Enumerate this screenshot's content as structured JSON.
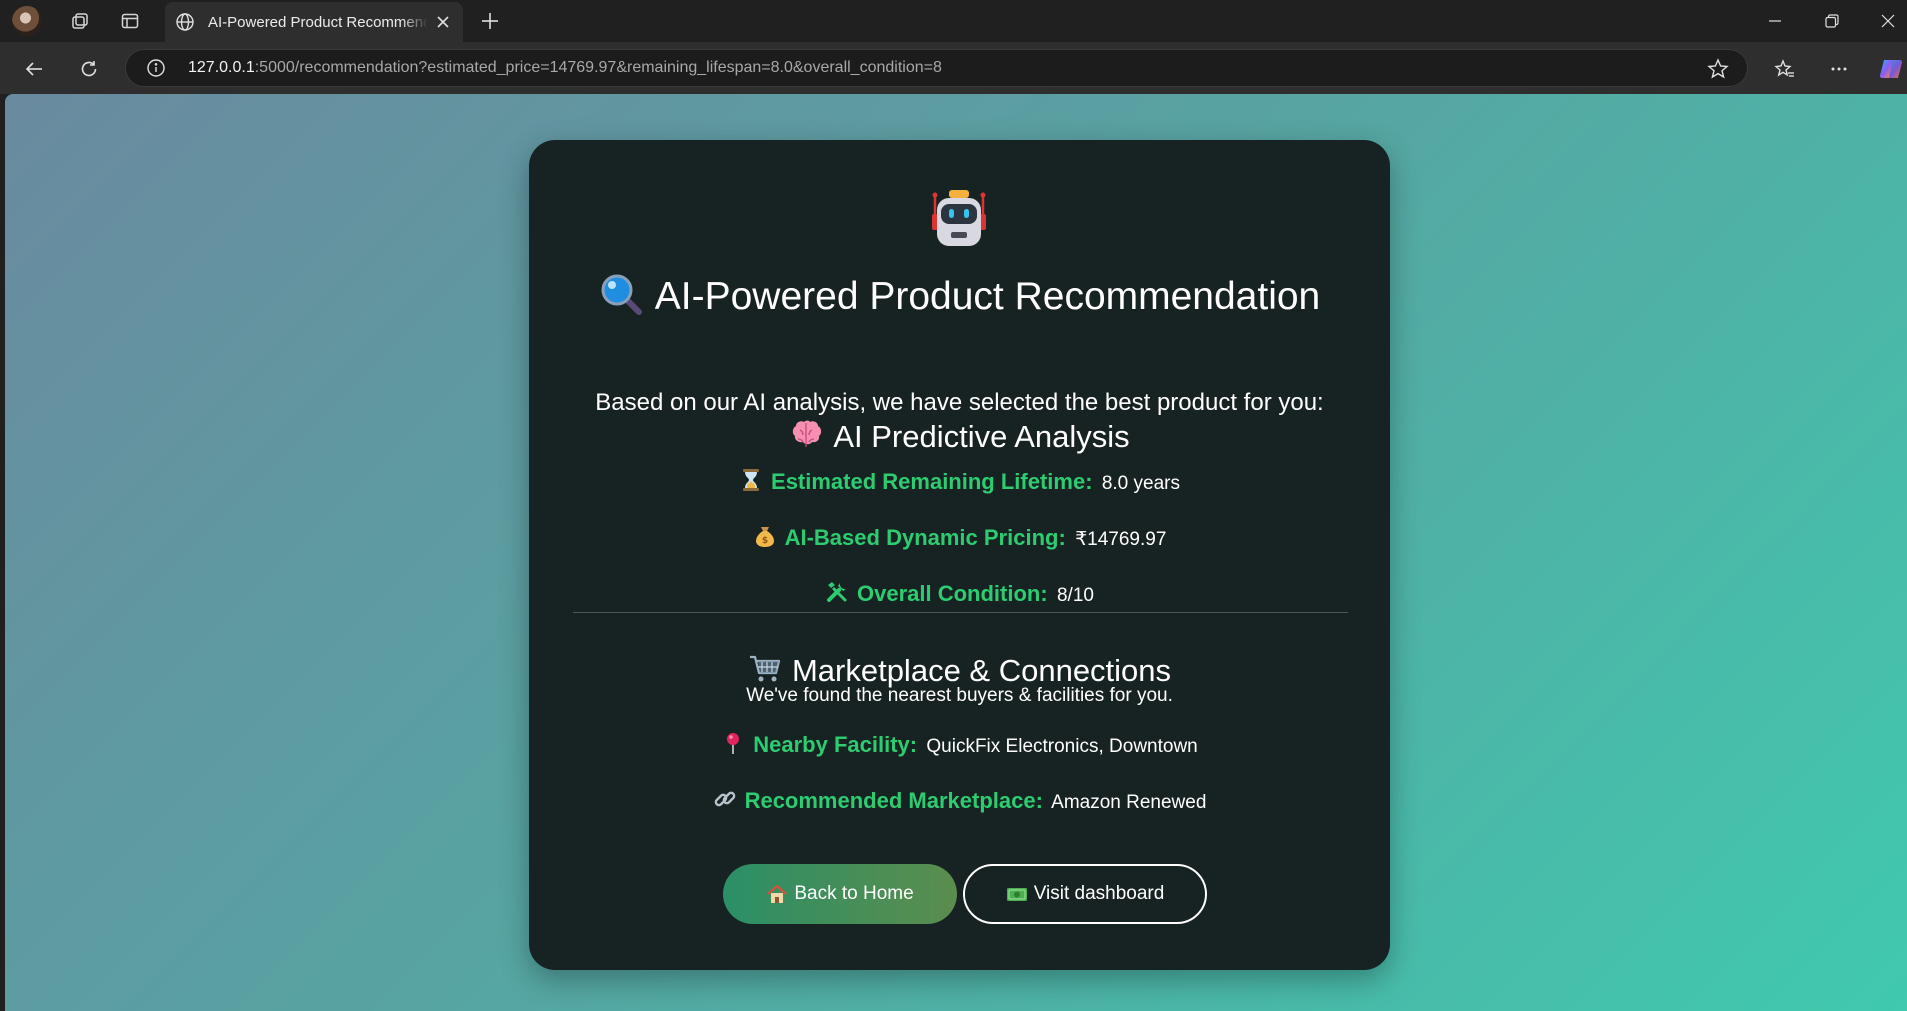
{
  "browser": {
    "tab_title": "AI-Powered Product Recommendation",
    "url_host": "127.0.0.1",
    "url_rest": ":5000/recommendation?estimated_price=14769.97&remaining_lifespan=8.0&overall_condition=8"
  },
  "page": {
    "title": "AI-Powered Product Recommendation",
    "lead": "Based on our AI analysis, we have selected the best product for you:",
    "analysis": {
      "heading": "AI Predictive Analysis",
      "lifetime_label": "Estimated Remaining Lifetime:",
      "lifetime_value": "8.0 years",
      "pricing_label": "AI-Based Dynamic Pricing:",
      "pricing_value": "₹14769.97",
      "condition_label": "Overall Condition:",
      "condition_value": "8/10"
    },
    "marketplace": {
      "heading": "Marketplace & Connections",
      "subtitle": "We've found the nearest buyers & facilities for you.",
      "facility_label": "Nearby Facility:",
      "facility_value": "QuickFix Electronics, Downtown",
      "market_label": "Recommended Marketplace:",
      "market_value": "Amazon Renewed"
    },
    "buttons": {
      "home": "Back to Home",
      "dashboard": "Visit dashboard"
    }
  },
  "colors": {
    "accent_green": "#2ecc71",
    "card_bg": "#172322",
    "page_gradient_start": "#6a8a9f",
    "page_gradient_end": "#40c9ae"
  },
  "icons": [
    "robot-icon",
    "magnifier-icon",
    "brain-icon",
    "hourglass-icon",
    "money-bag-icon",
    "tools-icon",
    "cart-icon",
    "pin-icon",
    "link-icon",
    "house-icon",
    "banknote-icon"
  ]
}
